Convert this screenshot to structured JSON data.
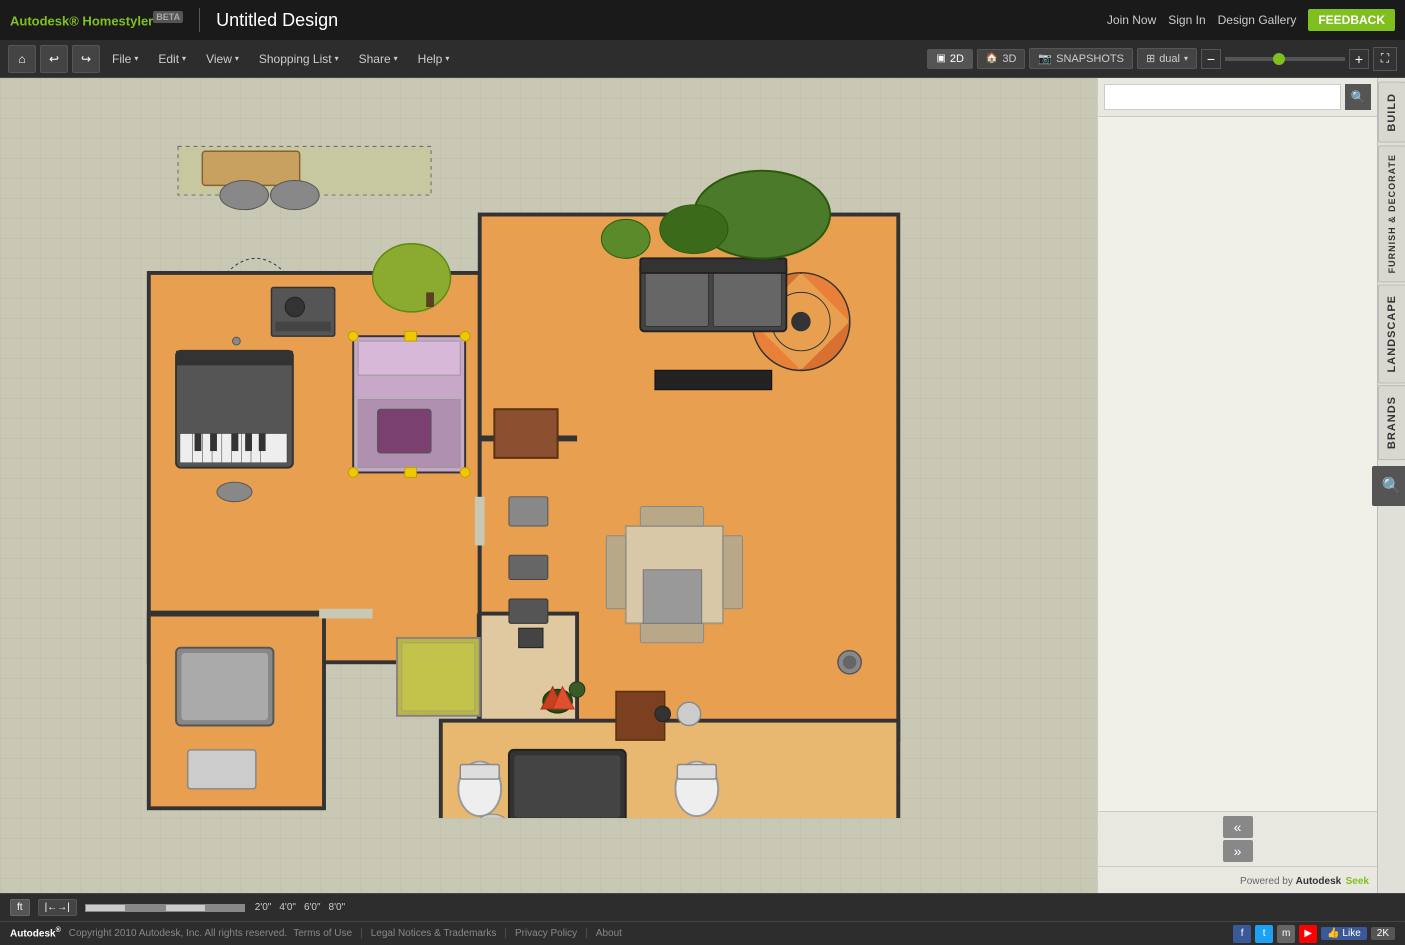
{
  "topbar": {
    "brand": "Autodesk",
    "brand_colored": "Homestyler",
    "beta": "BETA",
    "title": "Untitled Design",
    "join_now": "Join Now",
    "sign_in": "Sign In",
    "design_gallery": "Design Gallery",
    "feedback": "FEEDBACK"
  },
  "toolbar": {
    "file": "File",
    "edit": "Edit",
    "view": "View",
    "shopping_list": "Shopping List",
    "share": "Share",
    "help": "Help",
    "view_2d": "2D",
    "view_3d": "3D",
    "snapshots": "SNAPSHOTS",
    "dual": "dual"
  },
  "sidebar": {
    "build": "BUILD",
    "furnish": "FURNISH & DECORATE",
    "landscape": "LANDSCAPE",
    "brands": "BRANDS",
    "search_placeholder": "",
    "search_icon": "🔍",
    "collapse_up": "«",
    "collapse_down": "»",
    "powered_by": "Powered by Autodesk Seek"
  },
  "statusbar": {
    "unit": "ft",
    "measure": "←→",
    "scale_labels": [
      "2'0\"",
      "4'0\"",
      "6'0\"",
      "8'0\""
    ]
  },
  "footer": {
    "brand": "Autodesk®",
    "copyright": "Copyright 2010 Autodesk, Inc. All rights reserved.",
    "terms": "Terms of Use",
    "legal": "Legal Notices & Trademarks",
    "privacy": "Privacy Policy",
    "about": "About",
    "like": "Like",
    "k2": "2K"
  }
}
